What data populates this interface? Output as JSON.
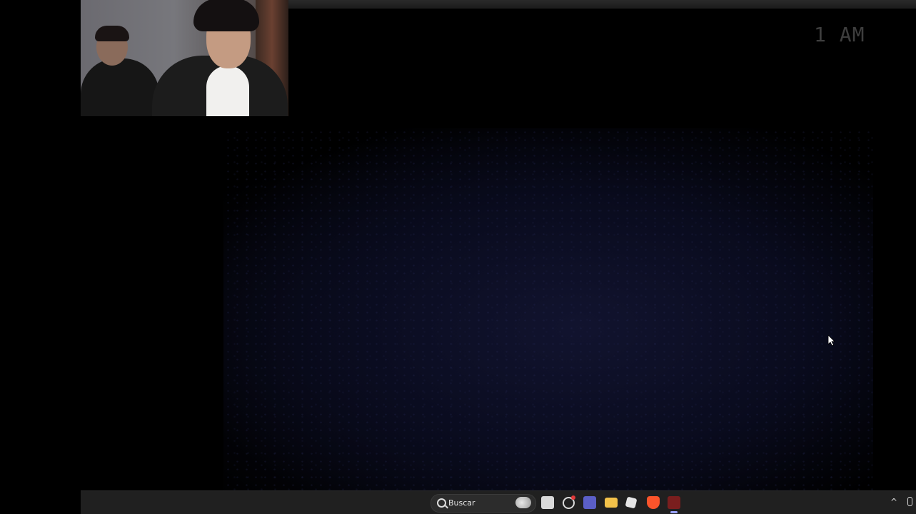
{
  "game": {
    "time_label": "1 AM"
  },
  "taskbar": {
    "search_placeholder": "Buscar",
    "icons": [
      "start-icon",
      "search-icon",
      "task-view-icon",
      "copilot-icon",
      "teams-icon",
      "file-explorer-icon",
      "roblox-icon",
      "brave-icon",
      "game-icon",
      "chevron-up-icon",
      "microphone-icon"
    ],
    "accent": "#3aa0f3"
  }
}
